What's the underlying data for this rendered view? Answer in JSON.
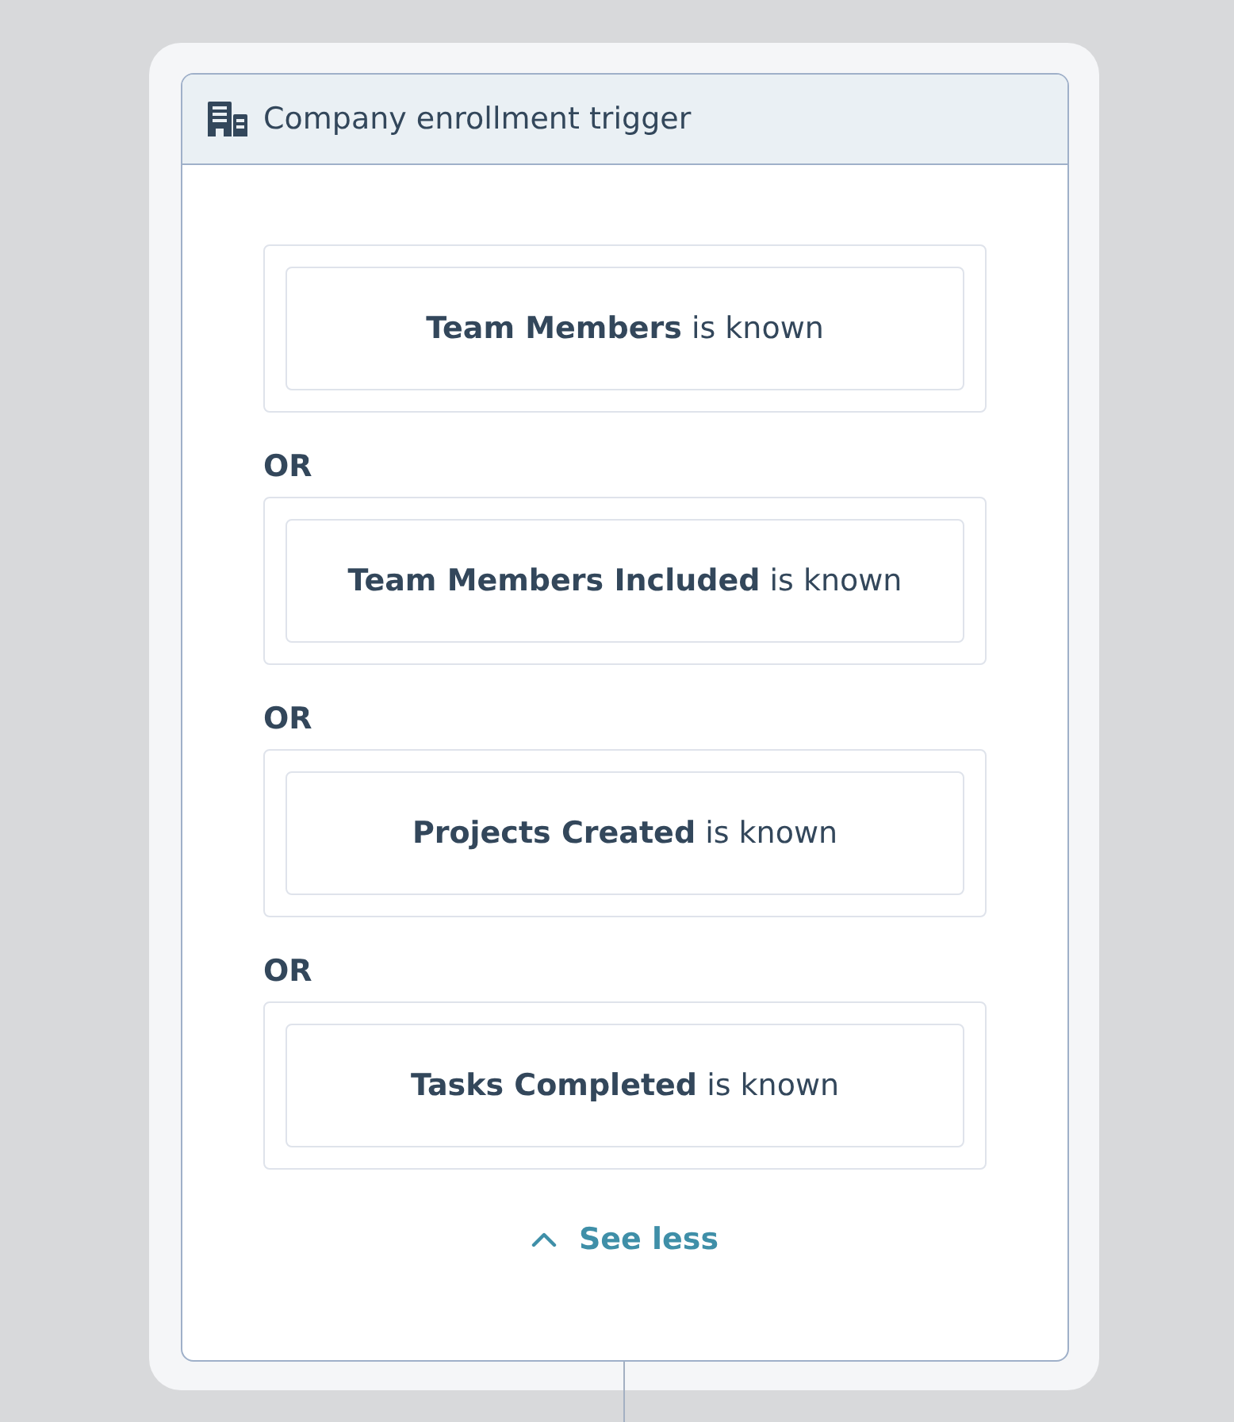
{
  "trigger": {
    "title": "Company enrollment trigger",
    "filters": [
      {
        "condition": "**Team Members** is known"
      },
      {
        "operator": "OR",
        "condition": "**Team Members Included** is known"
      },
      {
        "operator": "OR",
        "condition": "**Projects Created** is known"
      },
      {
        "operator": "OR",
        "condition": "**Tasks Completed** is known"
      }
    ],
    "toggle": {
      "label": "See less"
    }
  }
}
